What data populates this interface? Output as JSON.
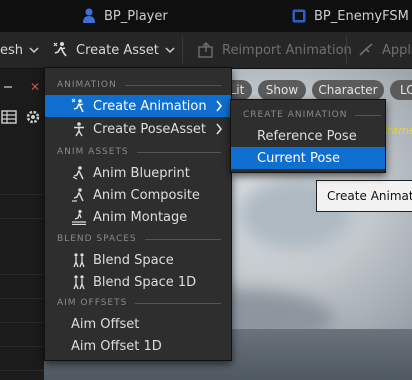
{
  "tabs": [
    {
      "label": "BP_Player",
      "icon": "person-icon"
    },
    {
      "label": "BP_EnemyFSM",
      "icon": "blueprint-icon"
    }
  ],
  "toolbar": {
    "mesh_label": "esh",
    "create_asset_label": "Create Asset",
    "reimport_label": "Reimport Animation",
    "apply_label": "Apply"
  },
  "viewport": {
    "pills": [
      "Lit",
      "Show",
      "Character",
      "LO"
    ],
    "overlay_text": "frame"
  },
  "menu": {
    "sections": [
      {
        "title": "ANIMATION",
        "items": [
          {
            "label": "Create Animation",
            "icon": "create-animation-icon",
            "submenu": true,
            "highlighted": true
          },
          {
            "label": "Create PoseAsset",
            "icon": "pose-asset-icon",
            "submenu": true
          }
        ]
      },
      {
        "title": "ANIM ASSETS",
        "items": [
          {
            "label": "Anim Blueprint",
            "icon": "anim-blueprint-icon"
          },
          {
            "label": "Anim Composite",
            "icon": "anim-composite-icon"
          },
          {
            "label": "Anim Montage",
            "icon": "anim-montage-icon"
          }
        ]
      },
      {
        "title": "BLEND SPACES",
        "items": [
          {
            "label": "Blend Space",
            "icon": "blend-space-icon"
          },
          {
            "label": "Blend Space 1D",
            "icon": "blend-space-1d-icon"
          }
        ]
      },
      {
        "title": "AIM OFFSETS",
        "items": [
          {
            "label": "Aim Offset"
          },
          {
            "label": "Aim Offset 1D"
          }
        ]
      }
    ]
  },
  "submenu": {
    "title": "CREATE ANIMATION",
    "items": [
      {
        "label": "Reference Pose"
      },
      {
        "label": "Current Pose",
        "highlighted": true
      }
    ]
  },
  "tooltip": {
    "text": "Create Animation"
  },
  "colors": {
    "highlight": "#0e6fd1",
    "menu_bg": "#2e2e2e",
    "overlay_yellow": "#e8d43a"
  }
}
